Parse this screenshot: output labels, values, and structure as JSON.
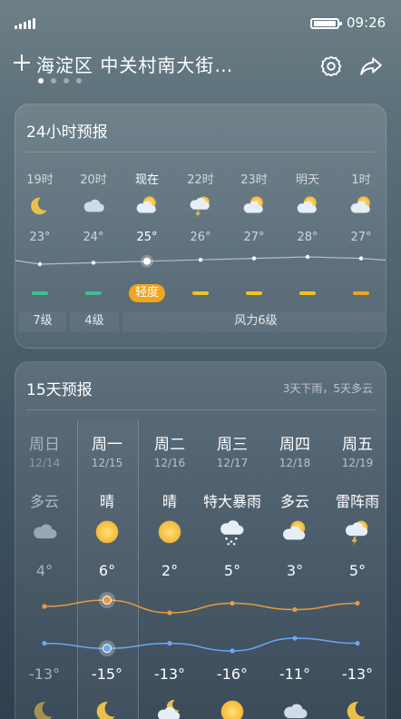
{
  "status_bar": {
    "time": "09:26"
  },
  "header": {
    "location": "海淀区 中关村南大街…",
    "page_count": 4,
    "active_page": 0
  },
  "hourly": {
    "title": "24小时预报",
    "hours": [
      {
        "label": "19时",
        "icon": "moon-icon",
        "temp": "23°",
        "aqi_color": "#3fbf92",
        "now": false
      },
      {
        "label": "20时",
        "icon": "cloud-icon",
        "temp": "24°",
        "aqi_color": "#3fbf92",
        "now": false
      },
      {
        "label": "现在",
        "icon": "partly-cloudy-sun-icon",
        "temp": "25°",
        "aqi_color": "#f0a51d",
        "now": true
      },
      {
        "label": "22时",
        "icon": "thunderstorm-icon",
        "temp": "26°",
        "aqi_color": "#f0c419",
        "now": false
      },
      {
        "label": "23时",
        "icon": "partly-cloudy-sun-icon",
        "temp": "27°",
        "aqi_color": "#f0c419",
        "now": false
      },
      {
        "label": "明天",
        "icon": "partly-cloudy-sun-icon",
        "temp": "28°",
        "aqi_color": "#f0c419",
        "now": false
      },
      {
        "label": "1时",
        "icon": "partly-cloudy-sun-icon",
        "temp": "27°",
        "aqi_color": "#f0a51d",
        "now": false
      }
    ],
    "aqi_badge": "轻度",
    "wind": [
      "7级",
      "4级",
      "风力6级"
    ]
  },
  "daily": {
    "title": "15天预报",
    "summary": "3天下雨，5天多云",
    "days": [
      {
        "name": "周日",
        "date": "12/14",
        "cond": "多云",
        "icon": "cloud-icon",
        "high": "4°",
        "low": "-13°",
        "night_icon": "moon-icon",
        "past": true
      },
      {
        "name": "周一",
        "date": "12/15",
        "cond": "晴",
        "icon": "sun-icon",
        "high": "6°",
        "low": "-15°",
        "night_icon": "moon-icon",
        "past": false
      },
      {
        "name": "周二",
        "date": "12/16",
        "cond": "晴",
        "icon": "sun-icon",
        "high": "2°",
        "low": "-13°",
        "night_icon": "partly-cloudy-moon-icon",
        "past": false
      },
      {
        "name": "周三",
        "date": "12/17",
        "cond": "特大暴雨",
        "icon": "heavy-rain-icon",
        "high": "5°",
        "low": "-16°",
        "night_icon": "sun-icon",
        "past": false
      },
      {
        "name": "周四",
        "date": "12/18",
        "cond": "多云",
        "icon": "partly-cloudy-sun-icon",
        "high": "3°",
        "low": "-11°",
        "night_icon": "cloud-icon",
        "past": false
      },
      {
        "name": "周五",
        "date": "12/19",
        "cond": "雷阵雨",
        "icon": "thunderstorm-icon",
        "high": "5°",
        "low": "-13°",
        "night_icon": "moon-icon",
        "past": false
      }
    ]
  },
  "colors": {
    "aqi_good": "#3fbf92",
    "aqi_moderate": "#f0c419",
    "aqi_light": "#f0a51d",
    "high_line": "#e89a3c",
    "low_line": "#6aa8f0"
  }
}
